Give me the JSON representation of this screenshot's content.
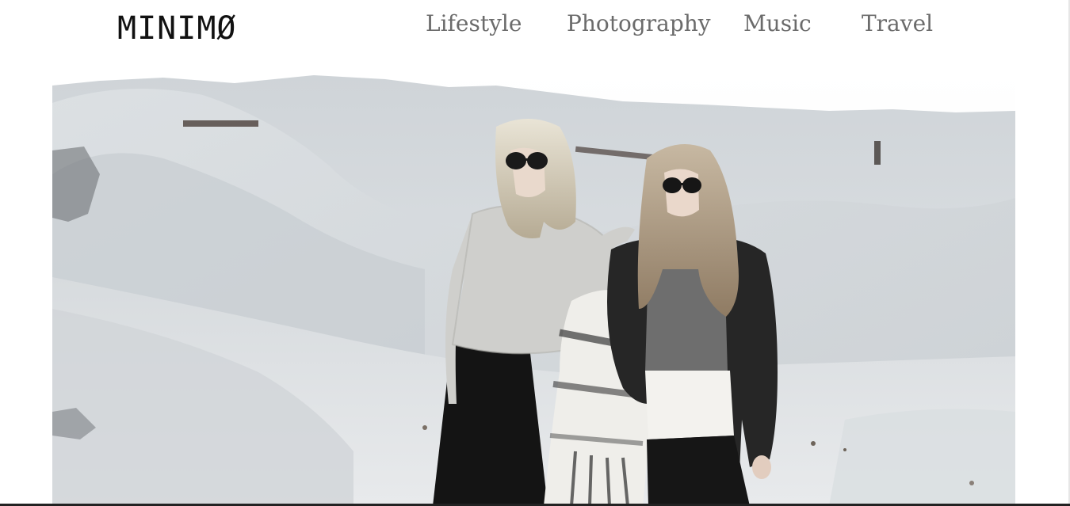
{
  "header": {
    "logo": "MINIMØ",
    "nav": [
      {
        "label": "Lifestyle"
      },
      {
        "label": "Photography"
      },
      {
        "label": "Music"
      },
      {
        "label": "Travel"
      }
    ]
  },
  "hero": {
    "icons": [
      "hero-photo-two-women-dunes"
    ]
  },
  "colors": {
    "background": "#ffffff",
    "logo": "#111111",
    "nav": "#6b6b6b",
    "sand": "#d8dde0"
  }
}
